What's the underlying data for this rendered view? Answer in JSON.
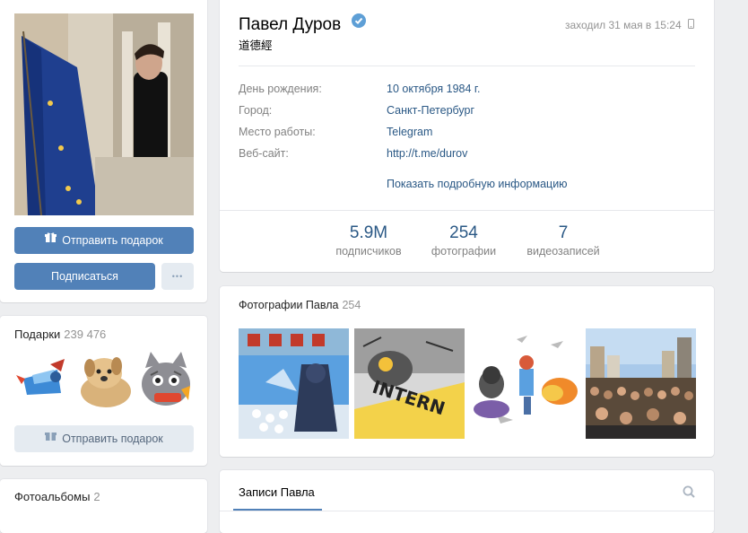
{
  "profile": {
    "name": "Павел Дуров",
    "status": "道德經",
    "last_seen": "заходил 31 мая в 15:24",
    "info": [
      {
        "label": "День рождения:",
        "value": "10 октября 1984 г."
      },
      {
        "label": "Город:",
        "value": "Санкт-Петербург"
      },
      {
        "label": "Место работы:",
        "value": "Telegram"
      },
      {
        "label": "Веб-сайт:",
        "value": "http://t.me/durov"
      }
    ],
    "more_link": "Показать подробную информацию",
    "counters": [
      {
        "value": "5.9M",
        "label": "подписчиков"
      },
      {
        "value": "254",
        "label": "фотографии"
      },
      {
        "value": "7",
        "label": "видеозаписей"
      }
    ]
  },
  "left": {
    "send_gift": "Отправить подарок",
    "subscribe": "Подписаться",
    "more": "•••",
    "gifts_title": "Подарки",
    "gifts_count": "239 476",
    "gifts_send": "Отправить подарок",
    "albums_title": "Фотоальбомы",
    "albums_count": "2"
  },
  "photos": {
    "title": "Фотографии Павла",
    "count": "254",
    "thumb_text": "INTERN"
  },
  "wall": {
    "tab": "Записи Павла"
  },
  "colors": {
    "accent": "#5181b8",
    "link": "#2a5885",
    "background": "#edeef0"
  },
  "icons": [
    "gift-icon",
    "verified-icon",
    "phone-icon",
    "search-icon"
  ]
}
